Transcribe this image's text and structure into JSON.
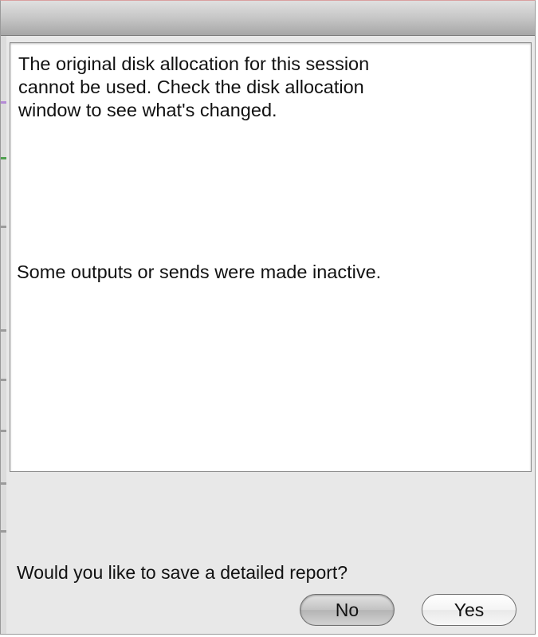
{
  "dialog": {
    "title": "",
    "message": "The original disk allocation for this session\ncannot be used.  Check the disk allocation\nwindow to see what's changed.",
    "message_secondary": "Some outputs or sends were made inactive.",
    "question": "Would you like to save a detailed report?",
    "buttons": {
      "no_label": "No",
      "yes_label": "Yes"
    }
  },
  "colors": {
    "window_bg": "#e8e8e8",
    "message_bg": "#ffffff",
    "text": "#111111",
    "titlebar_dark": "#a7a7a7"
  }
}
